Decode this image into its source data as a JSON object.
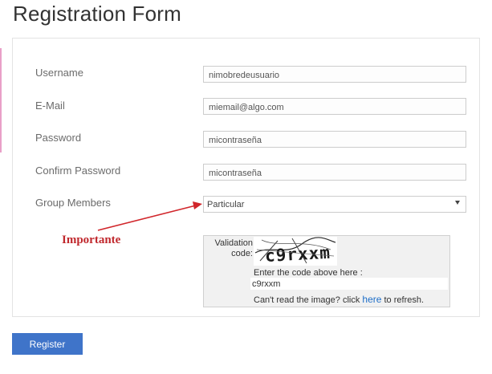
{
  "form": {
    "title": "Registration Form",
    "fields": [
      {
        "label": "Username",
        "value": "nimobredeusuario"
      },
      {
        "label": "E-Mail",
        "value": "miemail@algo.com"
      },
      {
        "label": "Password",
        "value": "micontraseña"
      },
      {
        "label": "Confirm Password",
        "value": "micontraseña"
      }
    ],
    "group": {
      "label": "Group Members",
      "selected": "Particular"
    }
  },
  "annotation": {
    "text": "Importante",
    "color": "#c0282d"
  },
  "captcha": {
    "label_line1": "Validation",
    "label_line2": "code:",
    "image_text": "c9rxxm",
    "enter_prompt": "Enter the code above here :",
    "entered_value": "c9rxxm",
    "refresh_prefix": "Can't read the image? click",
    "refresh_link": "here",
    "refresh_suffix": "to refresh."
  },
  "actions": {
    "register_label": "Register"
  },
  "colors": {
    "button": "#3f74c9",
    "link": "#1e6ec8"
  }
}
